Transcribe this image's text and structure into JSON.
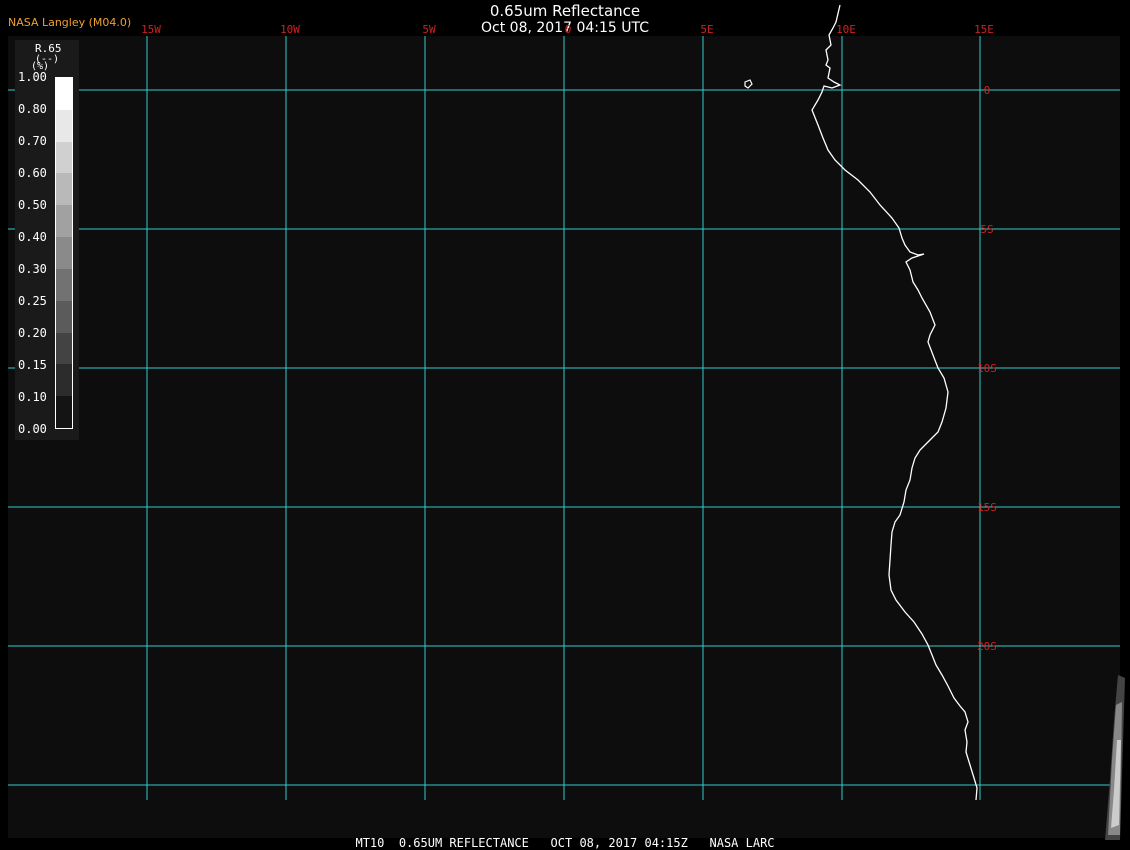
{
  "header": {
    "source": "NASA Langley (M04.0)",
    "title": "0.65um Reflectance",
    "subtitle": "Oct 08, 2017 04:15 UTC"
  },
  "legend": {
    "name": "R.65",
    "unit": "(--)",
    "marker": "(%)",
    "ticks": [
      "1.00",
      "0.80",
      "0.70",
      "0.60",
      "0.50",
      "0.40",
      "0.30",
      "0.25",
      "0.20",
      "0.15",
      "0.10",
      "0.00"
    ]
  },
  "map": {
    "lon_labels": [
      "15W",
      "10W",
      "5W",
      "0",
      "5E",
      "10E",
      "15E"
    ],
    "lat_labels": [
      "0",
      "5S",
      "10S",
      "15S",
      "20S"
    ],
    "grid_color": "#33cccc",
    "label_color": "#cc2222",
    "coast_color": "#ffffff"
  },
  "footer": {
    "caption": "MT10  0.65UM REFLECTANCE   OCT 08, 2017 04:15Z   NASA LARC"
  }
}
